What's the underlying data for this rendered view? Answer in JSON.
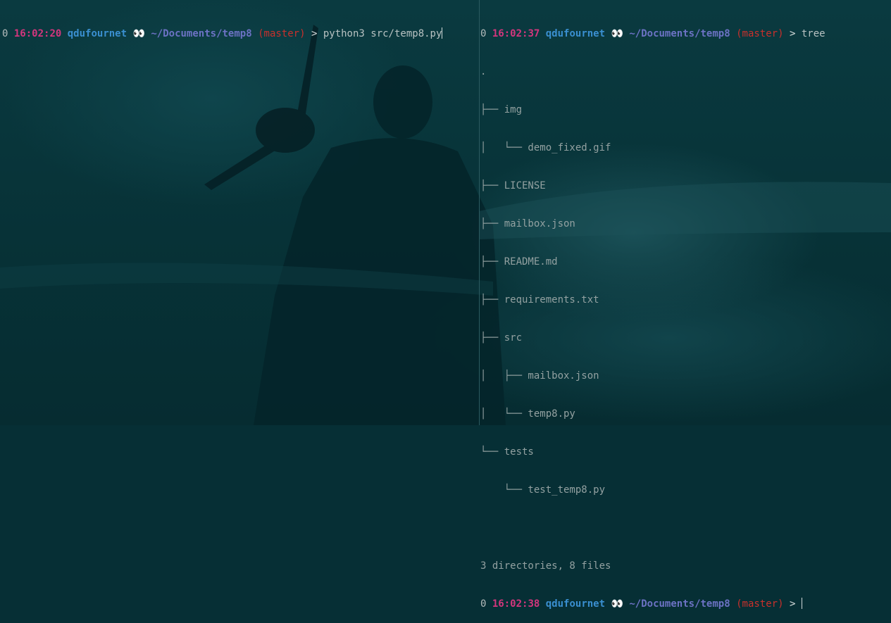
{
  "left_pane": {
    "prompt": {
      "code": "0",
      "time": "16:02:20",
      "user": "qdufournet",
      "eyes": "👀",
      "path": "~/Documents/temp8",
      "branch": "(master)",
      "arrow": ">",
      "command": "python3 src/temp8.py"
    }
  },
  "right_pane": {
    "prompt1": {
      "code": "0",
      "time": "16:02:37",
      "user": "qdufournet",
      "eyes": "👀",
      "path": "~/Documents/temp8",
      "branch": "(master)",
      "arrow": ">",
      "command": "tree"
    },
    "tree_lines": [
      ".",
      "├── img",
      "│   └── demo_fixed.gif",
      "├── LICENSE",
      "├── mailbox.json",
      "├── README.md",
      "├── requirements.txt",
      "├── src",
      "│   ├── mailbox.json",
      "│   └── temp8.py",
      "└── tests",
      "    └── test_temp8.py"
    ],
    "summary": "3 directories, 8 files",
    "prompt2": {
      "code": "0",
      "time": "16:02:38",
      "user": "qdufournet",
      "eyes": "👀",
      "path": "~/Documents/temp8",
      "branch": "(master)",
      "arrow": ">",
      "command": ""
    }
  },
  "colors": {
    "background": "#062f35",
    "time": "#d3367d",
    "user": "#3a8fd0",
    "path": "#6c72c4",
    "branch": "#c9302c",
    "text": "#93a1a1"
  }
}
